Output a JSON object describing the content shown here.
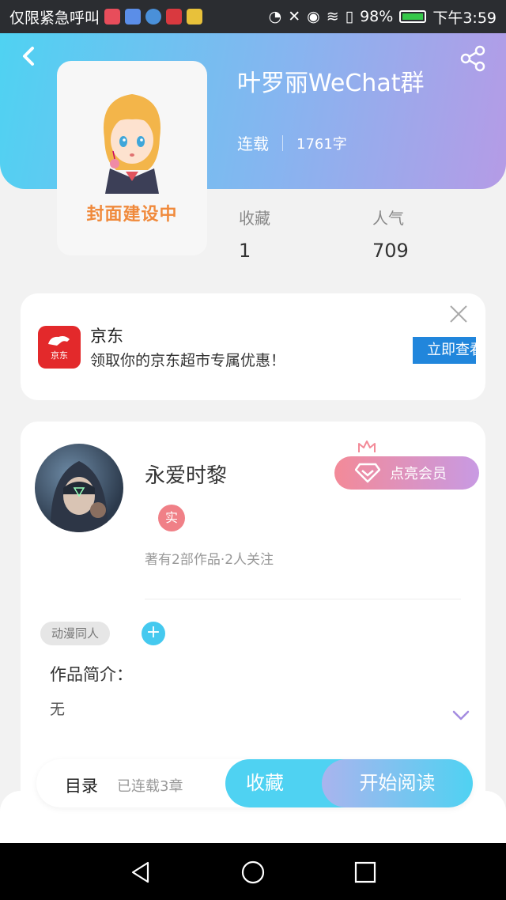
{
  "status_bar": {
    "carrier_text": "仅限紧急呼叫",
    "battery": "98%",
    "time": "下午3:59",
    "icons": [
      "app-icon",
      "music-icon",
      "browser-icon",
      "huawei-icon",
      "robot-icon",
      "data-icon",
      "mute-icon",
      "eye-icon",
      "wifi-icon",
      "alert-icon",
      "battery-icon"
    ]
  },
  "header": {
    "title": "叶罗丽WeChat群",
    "status": "连载",
    "word_count": "1761字",
    "cover_text": "封面建设中",
    "stats": [
      {
        "label": "收藏",
        "value": "1"
      },
      {
        "label": "人气",
        "value": "709"
      }
    ]
  },
  "ad": {
    "brand_logo_text": "京东",
    "name": "京东",
    "description": "领取你的京东超市专属优惠！",
    "cta": "立即查看"
  },
  "author": {
    "name": "永爱时黎",
    "verified_badge": "实",
    "stats": "著有2部作品·2人关注",
    "vip_button": "点亮会员",
    "tag": "动漫同人",
    "tag_add": "+",
    "intro_title": "作品简介：",
    "intro_text": "无"
  },
  "bottom_bar": {
    "toc_label": "目录",
    "toc_progress": "已连载3章",
    "favorite_button": "收藏",
    "read_button": "开始阅读"
  },
  "colors": {
    "accent_cyan": "#4fd2f2",
    "accent_purple": "#b59be6",
    "cover_text": "#f08a3c",
    "ad_brand": "#e3292b"
  }
}
